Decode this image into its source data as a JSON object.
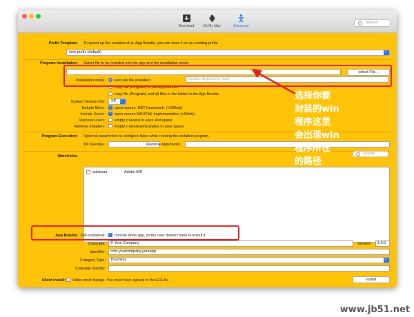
{
  "toolbar": {
    "items": [
      {
        "label": "Download",
        "icon": "download-icon"
      },
      {
        "label": "Oh My Mac",
        "icon": "puzzle-icon"
      },
      {
        "label": "Advanced",
        "icon": "figure-icon"
      }
    ],
    "search_placeholder": "Search"
  },
  "prefix_template": {
    "label": "Prefix Template:",
    "description": "To speed up the creation of an App Bundle, you can base it on an existing prefix.",
    "selected": "new prefix (default)"
  },
  "program_installation": {
    "label": "Program Installation:",
    "description": "Select file to be installed into the app and the installation mode.",
    "select_button": "select File...",
    "installation_mode_label": "Installation mode:",
    "options": [
      "execute file (installer)",
      "copy file (Program) to the App Bundle.",
      "copy file (Program) and all files in the folder to the App Bundle."
    ],
    "installer_args_placeholder": "Installer Arguments (opt)"
  },
  "system": {
    "version_label": "System Version Info:",
    "version_value": "XP",
    "mono_label": "Include Mono:",
    "mono_text": "open-source .NET framework. (+200mb)",
    "gecko_label": "Include Gecko:",
    "gecko_text": "open-source MSHTML implementation (+50mb)",
    "remove_users_label": "Remove Users:",
    "remove_users_text": "empty c:\\users\\ to save and space",
    "remove_installers_label": "Remove Installers:",
    "remove_installers_text": "empty c:\\windows\\installes to save space"
  },
  "program_execution": {
    "label": "Program Execution:",
    "description": "Optional parameters to configure Wine while running the installed program.",
    "dll_label": "Dll Overides:",
    "runtime_label": "Runtime Arguments:"
  },
  "winetricks": {
    "label": "Winetricks:",
    "search_placeholder": "Search",
    "rows": [
      {
        "name": "adobeair",
        "desc": "Adobe AIR"
      }
    ]
  },
  "app_bundle": {
    "label": "App Bundle:",
    "self_contained_label": "Self-contained:",
    "self_contained_text": "Include Wine.app, so the user doesn't have to install it.",
    "copyright_label": "Copyright:",
    "copyright_value": "© Your Company",
    "version_label": "Version:",
    "version_value": "1.0.0",
    "identifier_label": "Identifier:",
    "identifier_value": "com.yourcompany.yourapp",
    "category_label": "Category Type:",
    "category_value": "Business",
    "codesign_label": "Codesign Identity:"
  },
  "silent_install": {
    "label": "Silent Install:",
    "text": "Hides most dialogs. You must have agreed to the EULAs.",
    "install_button": "Install"
  },
  "annotation": {
    "lines": [
      "选择你要",
      "封装的win",
      "程序这里",
      "会出现win",
      "程序所在",
      "的路径"
    ],
    "color": "#e02020"
  },
  "watermark": "www.jb51.net"
}
